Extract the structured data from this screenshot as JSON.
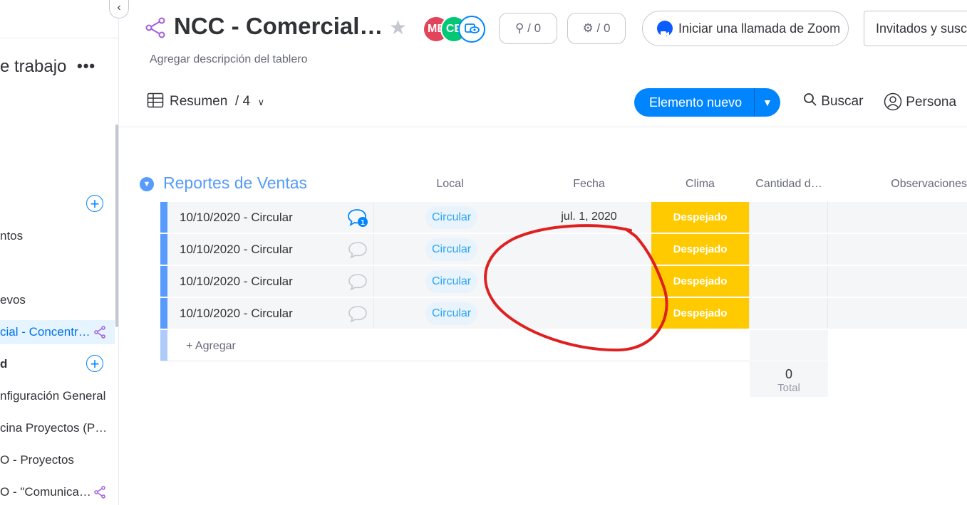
{
  "sidebar": {
    "workspace_title": "e trabajo",
    "more": "•••",
    "items": [
      {
        "label": "ntos"
      },
      {
        "label": "evos"
      },
      {
        "label": "cial - Concentr…"
      },
      {
        "label": "d"
      },
      {
        "label": "nfiguración General"
      },
      {
        "label": "cina Proyectos (P…"
      },
      {
        "label": "O - Proyectos"
      },
      {
        "label": "O - \"Comunica…"
      }
    ]
  },
  "header": {
    "title": "NCC - Comercial…",
    "description": "Agregar descripción del tablero",
    "avatars": [
      {
        "initials": "ME",
        "color": "#e2445c"
      },
      {
        "initials": "CE",
        "color": "#00c875"
      }
    ],
    "integrations_count": "/ 0",
    "automations_count": "/ 0",
    "zoom_label": "Iniciar una llamada de Zoom",
    "guests_label": "Invitados y suscr"
  },
  "toolbar": {
    "view_label": "Resumen",
    "view_count": "/ 4",
    "new_item_label": "Elemento nuevo",
    "search_label": "Buscar",
    "person_label": "Persona"
  },
  "group": {
    "title": "Reportes de Ventas",
    "color": "#579bfc",
    "columns": [
      "Local",
      "Fecha",
      "Clima",
      "Cantidad d…",
      "Observaciones"
    ],
    "rows": [
      {
        "name": "10/10/2020 - Circular",
        "updates": "1",
        "local": "Circular",
        "fecha": "jul. 1, 2020",
        "clima": "Despejado"
      },
      {
        "name": "10/10/2020 - Circular",
        "updates": "",
        "local": "Circular",
        "fecha": "",
        "clima": "Despejado"
      },
      {
        "name": "10/10/2020 - Circular",
        "updates": "",
        "local": "Circular",
        "fecha": "",
        "clima": "Despejado"
      },
      {
        "name": "10/10/2020 - Circular",
        "updates": "",
        "local": "Circular",
        "fecha": "",
        "clima": "Despejado"
      }
    ],
    "add_label": "+ Agregar",
    "total_value": "0",
    "total_label": "Total"
  },
  "colors": {
    "accent": "#0085ff",
    "clima": "#ffcb00",
    "annotation": "#e02020"
  }
}
